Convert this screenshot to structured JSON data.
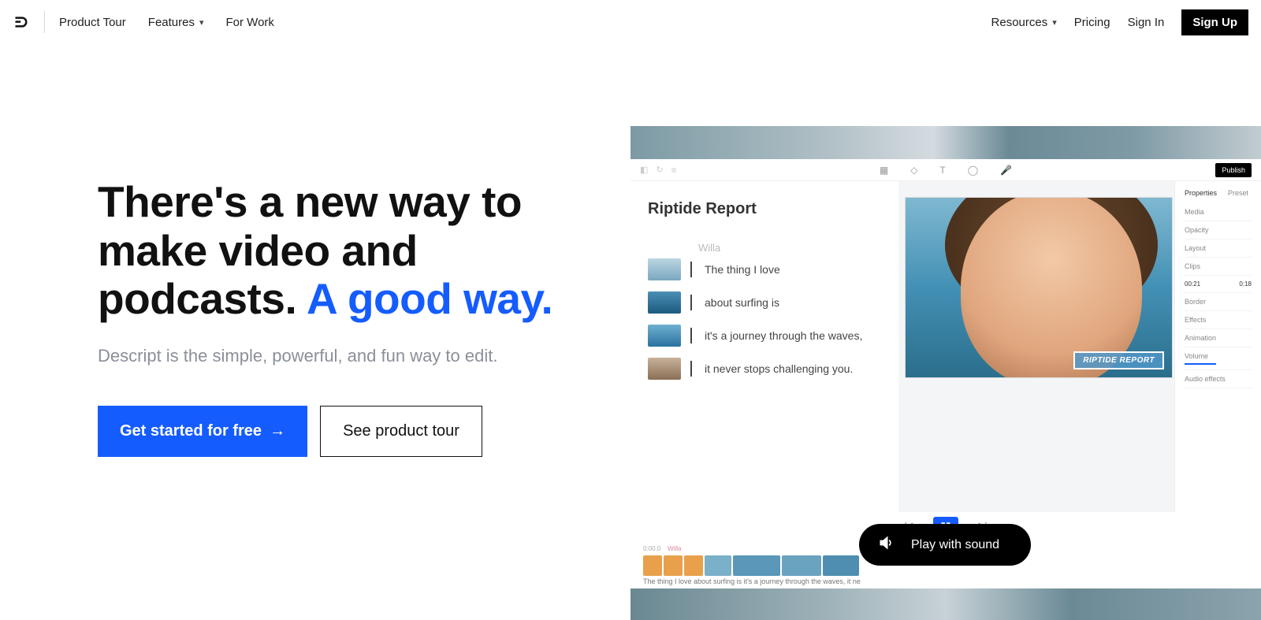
{
  "nav": {
    "product_tour": "Product Tour",
    "features": "Features",
    "for_work": "For Work",
    "resources": "Resources",
    "pricing": "Pricing",
    "sign_in": "Sign In",
    "sign_up": "Sign Up"
  },
  "hero": {
    "headline_plain": "There's a new way to make video and podcasts. ",
    "headline_accent": "A good way.",
    "sub": "Descript is the simple, powerful, and fun way to edit.",
    "cta_primary": "Get started for free",
    "cta_primary_arrow": "→",
    "cta_secondary": "See product tour"
  },
  "demo": {
    "publish": "Publish",
    "doc_title": "Riptide Report",
    "speaker": "Willa",
    "lines": [
      "The thing I love",
      "about surfing is",
      "it's a journey through the waves,",
      "it never stops challenging you."
    ],
    "lower_third": "RIPTIDE REPORT",
    "props": {
      "tab_properties": "Properties",
      "tab_preset": "Preset",
      "media": "Media",
      "opacity": "Opacity",
      "layout": "Layout",
      "clips": "Clips",
      "clip_in": "00:21",
      "clip_out": "0:18",
      "border": "Border",
      "effects": "Effects",
      "animation": "Animation",
      "volume": "Volume",
      "audio_effects": "Audio effects"
    },
    "timeline": {
      "time_label": "0:00.0",
      "speaker_label": "Willa",
      "caption": "The thing I love about surfing is it's a journey through the waves, it ne"
    }
  },
  "play_sound": "Play with sound"
}
